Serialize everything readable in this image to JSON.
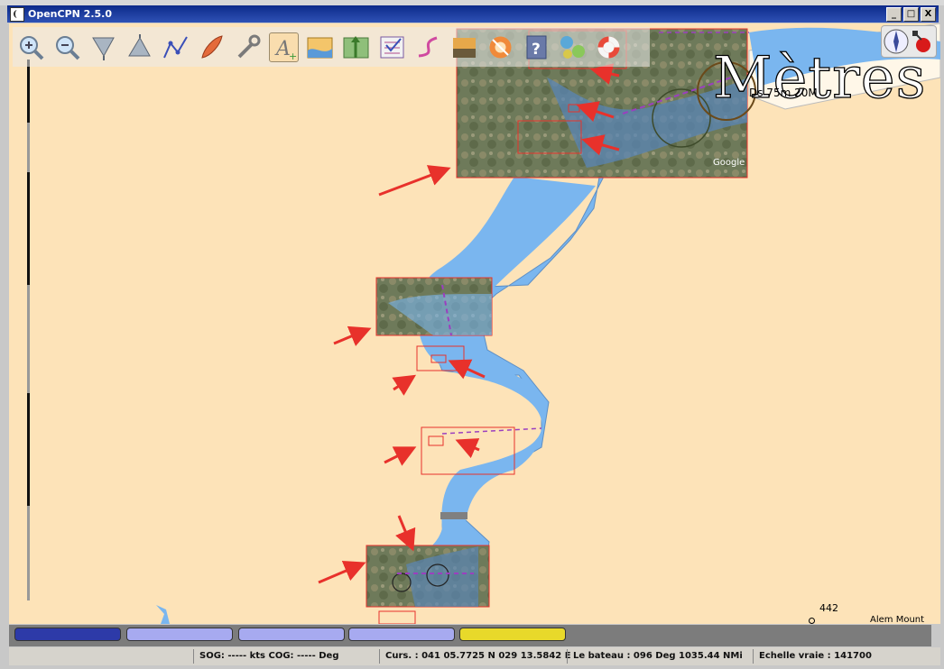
{
  "window": {
    "title": "OpenCPN 2.5.0",
    "minimize": "_",
    "maximize": "□",
    "close": "X"
  },
  "toolbar": {
    "tools": [
      {
        "icon": "zoom-in-icon"
      },
      {
        "icon": "zoom-out-icon"
      },
      {
        "icon": "scale-down-icon"
      },
      {
        "icon": "scale-up-icon"
      },
      {
        "icon": "route-icon"
      },
      {
        "icon": "boat-follow-icon"
      },
      {
        "icon": "settings-wrench-icon"
      },
      {
        "icon": "text-toggle-icon"
      },
      {
        "icon": "tide-icon"
      },
      {
        "icon": "current-icon"
      },
      {
        "icon": "route-manager-icon"
      },
      {
        "icon": "track-icon"
      },
      {
        "icon": "color-scheme-icon"
      },
      {
        "icon": "mob-icon"
      },
      {
        "icon": "help-icon"
      },
      {
        "icon": "plugin-icon"
      },
      {
        "icon": "lifebuoy-icon"
      }
    ]
  },
  "chart": {
    "units_overlay": "Mètres",
    "depth_info": "Ds 75m 20M",
    "sounding": "442",
    "place_name": "Alem Mount",
    "google_credit": "Google"
  },
  "piano_colors": [
    "#2d3aa8",
    "#a7aaf0",
    "#a7aaf0",
    "#a7aaf0",
    "#a7aaf0",
    "#e8d92a"
  ],
  "status": {
    "sog_cog": "SOG: ----- kts  COG: ----- Deg",
    "cursor": "Curs. : 041 05.7725 N 029 13.5842 E",
    "boat": "Le  bateau : 096 Deg  1035.44 NMi",
    "scale": "Echelle vraie :   141700"
  },
  "colors": {
    "land": "#fde3b8",
    "water": "#7ab6ef",
    "annotation_red": "#e8312b",
    "title_blue": "#0c2a8a"
  }
}
